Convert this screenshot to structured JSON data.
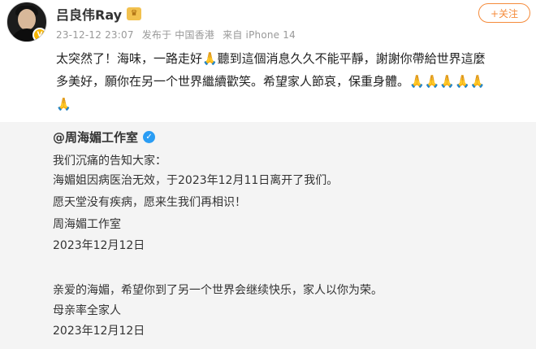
{
  "user": {
    "name": "吕良伟Ray",
    "verified": true
  },
  "meta": {
    "time": "23-12-12 23:07",
    "location": "发布于 中国香港",
    "device": "来自 iPhone 14"
  },
  "follow_label": "+关注",
  "post": {
    "line1": "太突然了！海味，一路走好🙏聽到這個消息久久不能平靜，謝謝你帶給世界這麼",
    "line2": "多美好，願你在另一个世界繼續歡笑。希望家人節哀，保重身體。🙏🙏🙏🙏🙏",
    "line3": "🙏"
  },
  "repost": {
    "account": "@周海媚工作室",
    "lines": [
      "我们沉痛的告知大家：",
      "海媚姐因病医治无效，于2023年12月11日离开了我们。",
      "愿天堂没有疾病，愿来生我们再相识！",
      "周海媚工作室",
      "2023年12月12日",
      "亲爱的海媚，希望你到了另一个世界会继续快乐，家人以你为荣。",
      "母亲率全家人",
      "2023年12月12日"
    ]
  },
  "colors": {
    "accent": "#f58b3b",
    "verified": "#2a9df4",
    "repost_bg": "#f4f4f4"
  }
}
